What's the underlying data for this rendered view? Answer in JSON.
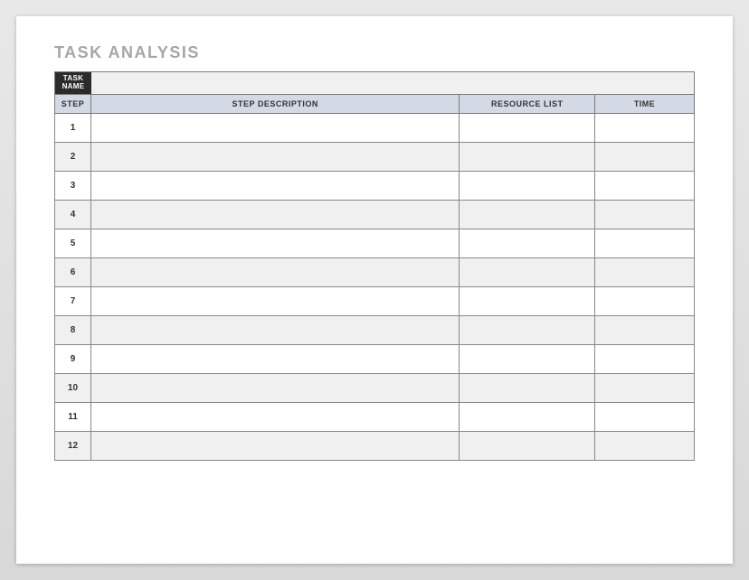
{
  "title": "TASK ANALYSIS",
  "taskName": {
    "label": "TASK NAME",
    "value": ""
  },
  "columns": {
    "step": "STEP",
    "description": "STEP DESCRIPTION",
    "resource": "RESOURCE LIST",
    "time": "TIME"
  },
  "rows": [
    {
      "step": "1",
      "description": "",
      "resource": "",
      "time": ""
    },
    {
      "step": "2",
      "description": "",
      "resource": "",
      "time": ""
    },
    {
      "step": "3",
      "description": "",
      "resource": "",
      "time": ""
    },
    {
      "step": "4",
      "description": "",
      "resource": "",
      "time": ""
    },
    {
      "step": "5",
      "description": "",
      "resource": "",
      "time": ""
    },
    {
      "step": "6",
      "description": "",
      "resource": "",
      "time": ""
    },
    {
      "step": "7",
      "description": "",
      "resource": "",
      "time": ""
    },
    {
      "step": "8",
      "description": "",
      "resource": "",
      "time": ""
    },
    {
      "step": "9",
      "description": "",
      "resource": "",
      "time": ""
    },
    {
      "step": "10",
      "description": "",
      "resource": "",
      "time": ""
    },
    {
      "step": "11",
      "description": "",
      "resource": "",
      "time": ""
    },
    {
      "step": "12",
      "description": "",
      "resource": "",
      "time": ""
    }
  ]
}
